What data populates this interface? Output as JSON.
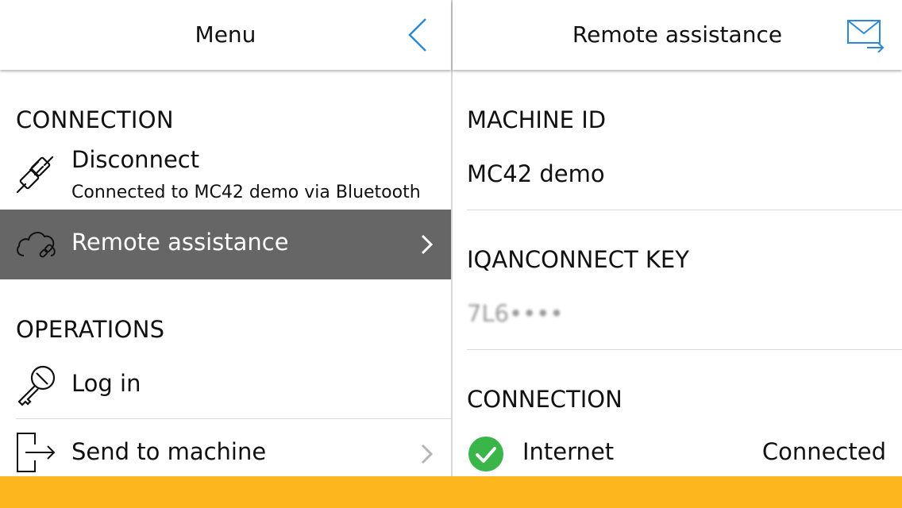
{
  "menu": {
    "title": "Menu",
    "back_icon": "chevron-left-icon",
    "accent_color": "#2b8ad8",
    "sections": {
      "connection": {
        "heading": "CONNECTION",
        "disconnect": {
          "label": "Disconnect",
          "sub": "Connected to MC42 demo via Bluetooth",
          "icon": "plug-icon"
        },
        "remote": {
          "label": "Remote assistance",
          "icon": "cloud-link-icon",
          "selected": true
        }
      },
      "operations": {
        "heading": "OPERATIONS",
        "login": {
          "label": "Log in",
          "icon": "key-icon"
        },
        "send": {
          "label": "Send to machine",
          "icon": "send-to-icon"
        }
      }
    },
    "selected_bg": "#666666"
  },
  "remote": {
    "title": "Remote assistance",
    "mail_icon": "mail-send-icon",
    "machine_id": {
      "label": "MACHINE ID",
      "value": "MC42 demo"
    },
    "key": {
      "label": "IQANCONNECT KEY",
      "value": "7L6••••"
    },
    "connection": {
      "heading": "CONNECTION",
      "items": [
        {
          "name": "Internet",
          "status": "Connected",
          "icon": "check-circle-icon",
          "color": "#39b54a"
        }
      ]
    }
  },
  "footer_color": "#fdb61e"
}
